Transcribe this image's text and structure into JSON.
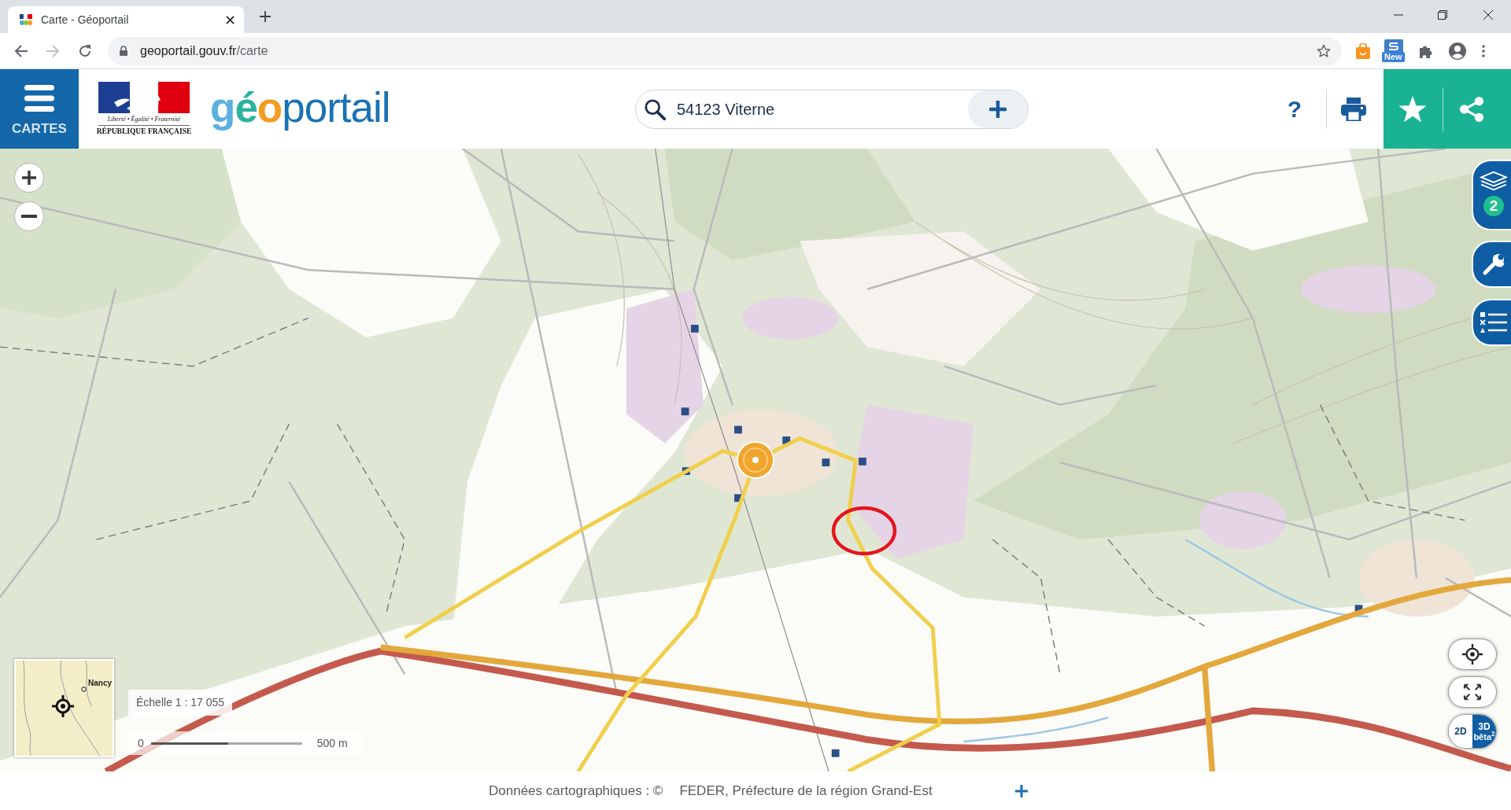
{
  "browser": {
    "tab": {
      "title": "Carte - Géoportail"
    },
    "url": {
      "domain": "geoportail.gouv.fr",
      "path": "/carte"
    },
    "extension_badge": "New"
  },
  "header": {
    "menu_label": "CARTES",
    "emblem": {
      "motto": "Liberté • Égalité • Fraternité",
      "name": "RÉPUBLIQUE FRANÇAISE"
    },
    "brand": "géoportail",
    "search": {
      "value": "54123 Viterne"
    },
    "help": "?"
  },
  "side_panel": {
    "layers_count": "2"
  },
  "map": {
    "minimap_label": "Nancy",
    "scale": {
      "label": "Échelle 1 : 17 055",
      "start": "0",
      "end": "500 m"
    },
    "view_modes": [
      {
        "label": "2D",
        "selected": false
      },
      {
        "label": "3D",
        "note": "bêta$^{2}$",
        "selected": true
      }
    ]
  },
  "footer": {
    "attribution": [
      "Données cartographiques : ©",
      "FEDER, Préfecture de la région Grand-Est"
    ]
  }
}
